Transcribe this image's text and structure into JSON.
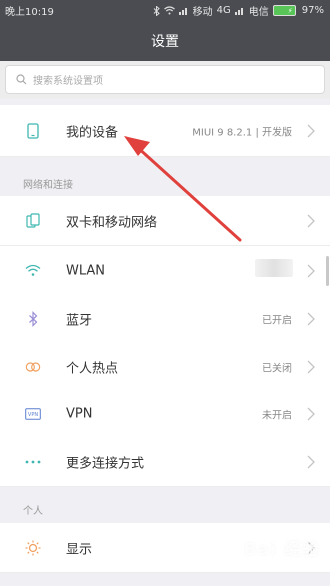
{
  "status_bar": {
    "time": "晚上10:19",
    "carrier_1": "移动",
    "network": "4G",
    "carrier_2": "电信",
    "battery": "97%"
  },
  "header": {
    "title": "设置"
  },
  "search": {
    "placeholder": "搜索系统设置项"
  },
  "my_device": {
    "label": "我的设备",
    "value": "MIUI 9 8.2.1 | 开发版"
  },
  "sections": {
    "network": "网络和连接",
    "personal": "个人"
  },
  "network_items": [
    {
      "label": "双卡和移动网络",
      "value": ""
    },
    {
      "label": "WLAN",
      "value": ""
    },
    {
      "label": "蓝牙",
      "value": "已开启"
    },
    {
      "label": "个人热点",
      "value": "已关闭"
    },
    {
      "label": "VPN",
      "value": "未开启"
    },
    {
      "label": "更多连接方式",
      "value": ""
    }
  ],
  "personal_items": [
    {
      "label": "显示",
      "value": ""
    }
  ],
  "colors": {
    "header_bg": "#4a4c51",
    "accent_teal": "#3fb7b0",
    "arrow_red": "#e0413c",
    "battery_green": "#59c457"
  },
  "icons": {
    "my_device": "phone-icon",
    "sim": "dual-sim-icon",
    "wlan": "wifi-icon",
    "bluetooth": "bluetooth-icon",
    "hotspot": "hotspot-icon",
    "vpn": "vpn-icon",
    "more": "more-dots-icon",
    "display": "display-sun-icon"
  },
  "watermark": "Bai 经验"
}
